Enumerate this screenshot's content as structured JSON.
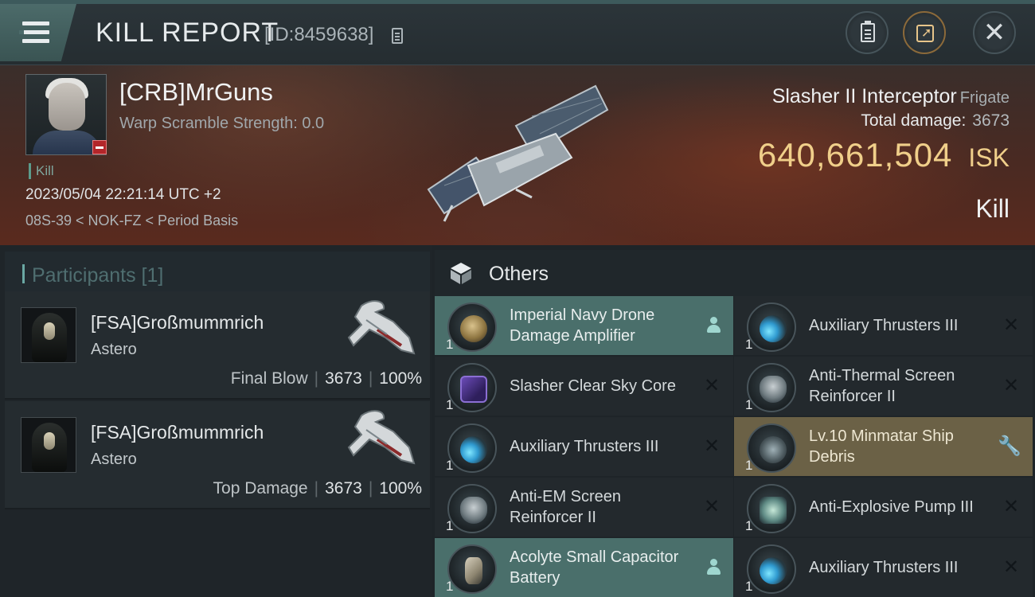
{
  "header": {
    "title": "KILL REPORT",
    "report_id": "[ID:8459638]",
    "icons": [
      "menu-icon",
      "copy-icon",
      "clipboard-icon",
      "share-icon",
      "close-icon"
    ]
  },
  "victim": {
    "name": "[CRB]MrGuns",
    "scramble": "Warp Scramble Strength: 0.0",
    "kill_tag": "Kill",
    "datetime": "2023/05/04 22:21:14 UTC +2",
    "location": "08S-39 < NOK-FZ < Period Basis"
  },
  "ship": {
    "name": "Slasher II Interceptor",
    "class": "Frigate",
    "total_damage_label": "Total damage:",
    "total_damage": "3673",
    "isk_value": "640,661,504",
    "isk_unit": "ISK",
    "result": "Kill"
  },
  "participants": {
    "title": "Participants [1]",
    "rows": [
      {
        "name": "[FSA]Großmummrich",
        "ship": "Astero",
        "role": "Final Blow",
        "damage": "3673",
        "percent": "100%"
      },
      {
        "name": "[FSA]Großmummrich",
        "ship": "Astero",
        "role": "Top Damage",
        "damage": "3673",
        "percent": "100%"
      }
    ]
  },
  "others": {
    "title": "Others",
    "items": [
      {
        "name": "Imperial Navy Drone Damage Amplifier",
        "qty": "1",
        "tier": "",
        "state": "equipped"
      },
      {
        "name": "Auxiliary Thrusters III",
        "qty": "1",
        "tier": "III",
        "state": "destroyed"
      },
      {
        "name": "Slasher Clear Sky Core",
        "qty": "1",
        "tier": "",
        "state": "destroyed"
      },
      {
        "name": "Anti-Thermal Screen Reinforcer II",
        "qty": "1",
        "tier": "II",
        "state": "destroyed"
      },
      {
        "name": "Auxiliary Thrusters III",
        "qty": "1",
        "tier": "III",
        "state": "destroyed"
      },
      {
        "name": "Lv.10 Minmatar Ship Debris",
        "qty": "1",
        "tier": "",
        "state": "dropped"
      },
      {
        "name": "Anti-EM Screen Reinforcer II",
        "qty": "1",
        "tier": "II",
        "state": "destroyed"
      },
      {
        "name": "Anti-Explosive Pump III",
        "qty": "1",
        "tier": "III",
        "state": "destroyed"
      },
      {
        "name": "Acolyte Small Capacitor Battery",
        "qty": "1",
        "tier": "",
        "state": "equipped"
      },
      {
        "name": "Auxiliary Thrusters III",
        "qty": "1",
        "tier": "III",
        "state": "destroyed"
      }
    ]
  },
  "colors": {
    "isk": "#f0cf8a",
    "equipped_row": "#4a6f6b",
    "dropped_row": "#6b6146",
    "accent": "#6aa8a3"
  }
}
